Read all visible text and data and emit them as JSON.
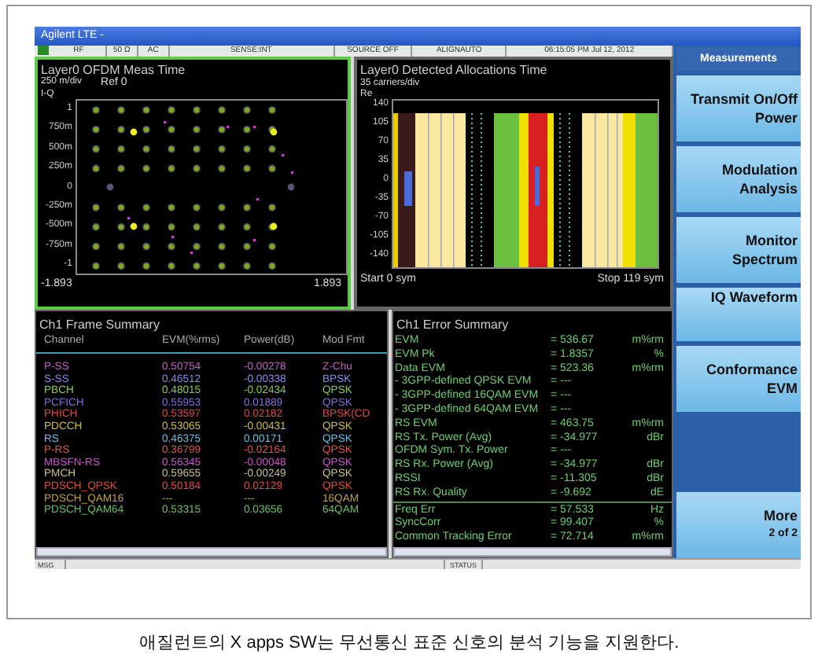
{
  "window": {
    "title": "Agilent LTE -"
  },
  "status_strip": [
    "RF",
    "50 Ω",
    "AC",
    "SENSE:INT",
    "SOURCE OFF",
    "ALIGNAUTO",
    "06:15:05 PM Jul 12, 2012"
  ],
  "constellation": {
    "title": "Layer0 OFDM Meas Time",
    "scale": "250 m/div",
    "ref": "Ref 0",
    "axis_name": "I-Q",
    "y_ticks": [
      "1",
      "750m",
      "500m",
      "250m",
      "0",
      "-250m",
      "-500m",
      "-750m",
      "-1"
    ],
    "x_start": "-1.893",
    "x_end": "1.893"
  },
  "allocations": {
    "title": "Layer0 Detected Allocations Time",
    "scale": "35 carriers/div",
    "axis_name": "Re",
    "y_ticks": [
      "140",
      "105",
      "70",
      "35",
      "0",
      "-35",
      "-70",
      "-105",
      "-140"
    ],
    "x_start": "Start 0 sym",
    "x_end": "Stop 119 sym"
  },
  "frame_summary": {
    "title": "Ch1 Frame Summary",
    "columns": [
      "Channel",
      "EVM(%rms)",
      "Power(dB)",
      "Mod Fmt"
    ],
    "rows": [
      {
        "cells": [
          "P-SS",
          "0.50754",
          "-0.00278",
          "Z-Chu"
        ],
        "color": "#c060c0"
      },
      {
        "cells": [
          "S-SS",
          "0.46512",
          "-0.00338",
          "BPSK"
        ],
        "color": "#8a8ae8"
      },
      {
        "cells": [
          "PBCH",
          "0.48015",
          "-0.02434",
          "QPSK"
        ],
        "color": "#80d040"
      },
      {
        "cells": [
          "PCFICH",
          "0.55953",
          "0.01889",
          "QPSK"
        ],
        "color": "#8868e0"
      },
      {
        "cells": [
          "PHICH",
          "0.53597",
          "0.02182",
          "BPSK(CD"
        ],
        "color": "#e84040"
      },
      {
        "cells": [
          "PDCCH",
          "0.53065",
          "-0.00431",
          "QPSK"
        ],
        "color": "#c8c040"
      },
      {
        "cells": [
          "RS",
          "0.46375",
          "0.00171",
          "QPSK"
        ],
        "color": "#60c0e0"
      },
      {
        "cells": [
          "P-RS",
          "0.36799",
          "-0.02164",
          "QPSK"
        ],
        "color": "#e05050"
      },
      {
        "cells": [
          "MBSFN-RS",
          "0.56345",
          "-0.00048",
          "QPSK"
        ],
        "color": "#d050d0"
      },
      {
        "cells": [
          "PMCH",
          "0.59655",
          "-0.00249",
          "QPSK"
        ],
        "color": "#c8c088"
      },
      {
        "cells": [
          "PDSCH_QPSK",
          "0.50184",
          "0.02129",
          "QPSK"
        ],
        "color": "#e84830"
      },
      {
        "cells": [
          "PDSCH_QAM16",
          "---",
          "---",
          "16QAM"
        ],
        "color": "#c0a040"
      },
      {
        "cells": [
          "PDSCH_QAM64",
          "0.53315",
          "0.03656",
          "64QAM"
        ],
        "color": "#60c060"
      }
    ]
  },
  "error_summary": {
    "title": "Ch1 Error Summary",
    "sections": [
      [
        {
          "label": "EVM",
          "value": "= 536.67",
          "unit": "m%rm"
        },
        {
          "label": "EVM Pk",
          "value": "= 1.8357",
          "unit": "%"
        },
        {
          "label": "Data EVM",
          "value": "= 523.36",
          "unit": "m%rm"
        },
        {
          "label": "- 3GPP-defined QPSK EVM",
          "value": "= ---"
        },
        {
          "label": "- 3GPP-defined 16QAM EVM",
          "value": "= ---"
        },
        {
          "label": "- 3GPP-defined 64QAM EVM",
          "value": "= ---"
        },
        {
          "label": "RS EVM",
          "value": "= 463.75",
          "unit": "m%rm"
        },
        {
          "label": "RS Tx. Power (Avg)",
          "value": "= -34.977",
          "unit": "dBr"
        },
        {
          "label": "OFDM Sym. Tx. Power",
          "value": "= ---"
        },
        {
          "label": "RS Rx. Power (Avg)",
          "value": "= -34.977",
          "unit": "dBr"
        },
        {
          "label": "RSSI",
          "value": "= -11.305",
          "unit": "dBr"
        },
        {
          "label": "RS Rx. Quality",
          "value": "= -9.692",
          "unit": "dE"
        }
      ],
      [
        {
          "label": "Freq Err",
          "value": "= 57.533",
          "unit": "Hz"
        },
        {
          "label": "SyncCorr",
          "value": "= 99.407",
          "unit": "%"
        },
        {
          "label": "Common Tracking Error",
          "value": "= 72.714",
          "unit": "m%rm"
        }
      ]
    ]
  },
  "softkeys": [
    {
      "kind": "header",
      "lines": [
        "Measurements"
      ]
    },
    {
      "kind": "key",
      "lines": [
        "Transmit On/Off",
        "Power"
      ]
    },
    {
      "kind": "key",
      "lines": [
        "Modulation",
        "Analysis"
      ]
    },
    {
      "kind": "key",
      "lines": [
        "Monitor",
        "Spectrum"
      ]
    },
    {
      "kind": "short",
      "lines": [
        "IQ Waveform"
      ]
    },
    {
      "kind": "key",
      "lines": [
        "Conformance",
        "EVM"
      ]
    },
    {
      "kind": "more",
      "lines": [
        "More",
        "2 of 2"
      ]
    }
  ],
  "bottom_bar": {
    "msg": "MSG",
    "status": "STATUS"
  },
  "caption": "애질런트의 X apps SW는 무선통신 표준 신호의 분석 기능을 지원한다."
}
